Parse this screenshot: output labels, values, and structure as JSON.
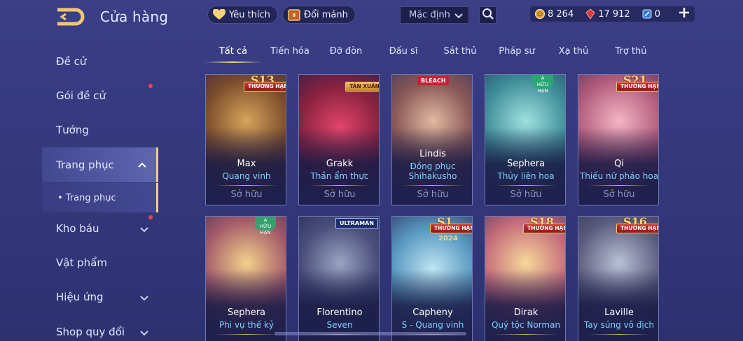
{
  "header": {
    "title": "Cửa hàng",
    "favorites_label": "Yêu thích",
    "exchange_label": "Đổi mảnh",
    "sort_value": "Mặc định"
  },
  "currencies": [
    {
      "icon": "gold-coin-icon",
      "value": "8 264"
    },
    {
      "icon": "red-gem-icon",
      "value": "17 912"
    },
    {
      "icon": "voucher-icon",
      "value": "0"
    }
  ],
  "sidebar": {
    "items": [
      {
        "label": "Đề cử"
      },
      {
        "label": "Gói đề cử"
      },
      {
        "label": "Tướng"
      },
      {
        "label": "Trang phục"
      },
      {
        "label": "• Trang phục"
      },
      {
        "label": "Kho báu"
      },
      {
        "label": "Vật phẩm"
      },
      {
        "label": "Hiệu ứng"
      },
      {
        "label": "Shop quy đổi"
      }
    ]
  },
  "tabs": [
    "Tất cả",
    "Tiến hóa",
    "Đỡ đòn",
    "Đấu sĩ",
    "Sát thủ",
    "Pháp sư",
    "Xạ thủ",
    "Trợ thủ"
  ],
  "cards": [
    {
      "hero": "Max",
      "skin": "Quang vinh",
      "status": "Sở hữu",
      "badge": "THƯỜNG HẠNG",
      "season": "S13"
    },
    {
      "hero": "Grakk",
      "skin": "Thần ẩm thực",
      "status": "Sở hữu",
      "badge": "TÂN XUÂN",
      "season": ""
    },
    {
      "hero": "Lindis",
      "skin": "Đồng phục\nShihakusho",
      "status": "Sở hữu",
      "badge": "BLEACH",
      "season": ""
    },
    {
      "hero": "Sephera",
      "skin": "Thủy liên hoa",
      "status": "Sở hữu",
      "badge": "",
      "season": "",
      "rare": "A\nHỮU HẠN"
    },
    {
      "hero": "Qi",
      "skin": "Thiếu nữ pháo hoa",
      "status": "Sở hữu",
      "badge": "THƯỜNG HẠNG",
      "season": "S21"
    },
    {
      "hero": "Sephera",
      "skin": "Phi vụ thế kỷ",
      "status": "",
      "badge": "",
      "season": "",
      "rare": "A\nHỮU HẠN"
    },
    {
      "hero": "Florentino",
      "skin": "Seven",
      "status": "",
      "badge": "ULTRAMAN",
      "season": ""
    },
    {
      "hero": "Capheny",
      "skin": "S - Quang vinh",
      "status": "",
      "badge": "THƯỜNG HẠNG",
      "season": "S1",
      "year": "2024"
    },
    {
      "hero": "Dirak",
      "skin": "Quý tộc Norman",
      "status": "",
      "badge": "THƯỜNG HẠNG",
      "season": "S18"
    },
    {
      "hero": "Laville",
      "skin": "Tay súng vô địch",
      "status": "",
      "badge": "THƯỜNG HẠNG",
      "season": "S16"
    }
  ],
  "colors": {
    "background": "#363b80",
    "accent_gold": "#f0cf7a",
    "skin_name": "#7fd0ff",
    "notification_dot": "#ff3b4f"
  }
}
